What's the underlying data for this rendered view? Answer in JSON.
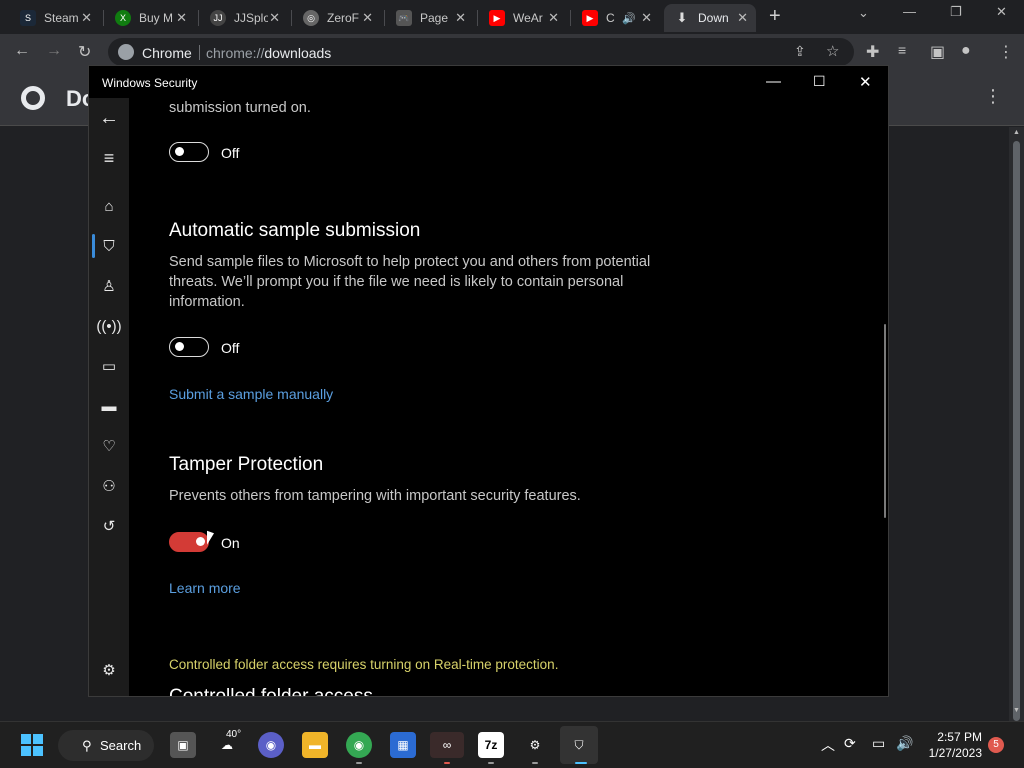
{
  "browser": {
    "tabs": [
      {
        "label": "Steam",
        "favicon": "steam-icon",
        "color": "#1b2838"
      },
      {
        "label": "Buy M",
        "favicon": "xbox-icon",
        "color": "#107c10"
      },
      {
        "label": "JJSplo",
        "favicon": "jj-icon",
        "color": "#444444"
      },
      {
        "label": "ZeroF",
        "favicon": "globe-icon",
        "color": "#666666"
      },
      {
        "label": "Page",
        "favicon": "gamepad-icon",
        "color": "#555555"
      },
      {
        "label": "WeAr",
        "favicon": "youtube-icon",
        "color": "#ff0000"
      },
      {
        "label": "C",
        "favicon": "youtube-icon",
        "color": "#ff0000"
      },
      {
        "label": "Down",
        "favicon": "download-icon",
        "color": "#35363a"
      }
    ],
    "omnibox": {
      "chip": "Chrome",
      "url_scheme": "chrome://",
      "url_host": "downloads"
    },
    "page_title": "Do"
  },
  "ws": {
    "title": "Windows Security",
    "sections": {
      "top_desc": "submission turned on.",
      "top_toggle": "Off",
      "auto_sample": {
        "heading": "Automatic sample submission",
        "desc": "Send sample files to Microsoft to help protect you and others from potential threats. We’ll prompt you if the file we need is likely to contain personal information.",
        "toggle": "Off",
        "link": "Submit a sample manually"
      },
      "tamper": {
        "heading": "Tamper Protection",
        "desc": "Prevents others from tampering with important security features.",
        "toggle": "On",
        "link": "Learn more"
      },
      "warning": "Controlled folder access requires turning on Real-time protection.",
      "cfa_heading": "Controlled folder access"
    },
    "accent": "#d33b36",
    "link_color": "#5b9fe0"
  },
  "taskbar": {
    "search": "Search",
    "weather": "40°",
    "time": "2:57 PM",
    "date": "1/27/2023",
    "notifications": "5"
  }
}
